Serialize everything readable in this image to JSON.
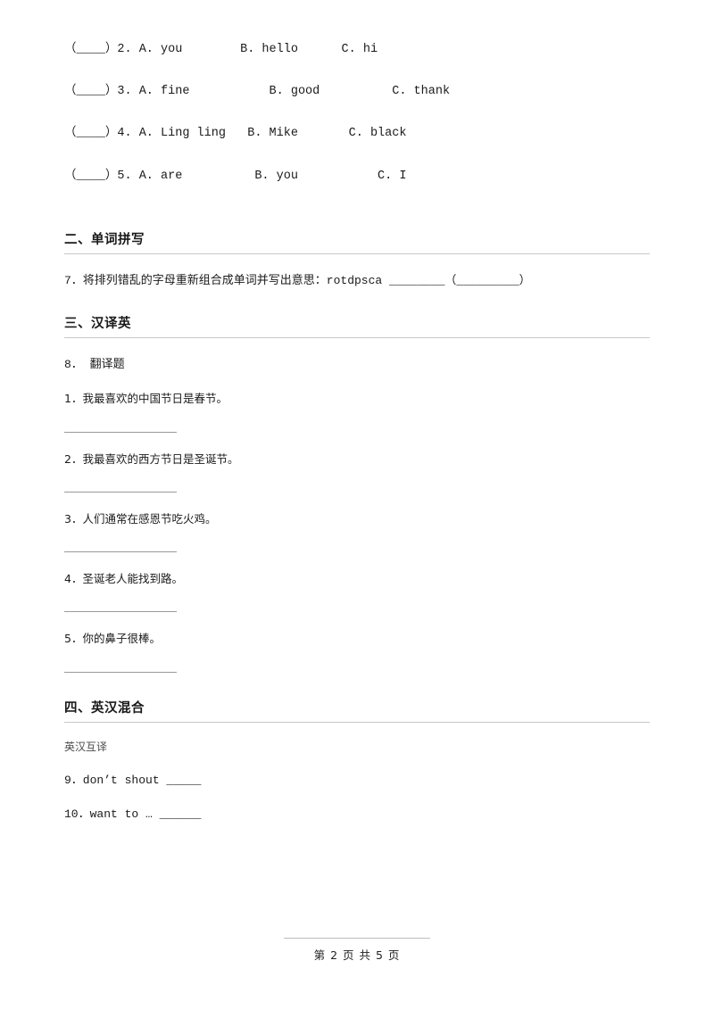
{
  "document": {
    "multiple_choice_continued": [
      "（____）2. A. you        B. hello      C. hi",
      "（____）3. A. fine           B. good          C. thank",
      "（____）4. A. Ling ling   B. Mike       C. black",
      "（____）5. A. are          B. you           C. I"
    ],
    "sections": [
      {
        "heading": "二、单词拼写",
        "items": [
          "7．将排列错乱的字母重新组合成单词并写出意思：rotdpsca ________（_________）"
        ]
      },
      {
        "heading": "三、汉译英",
        "title": "8． 翻译题",
        "questions": [
          "1．我最喜欢的中国节日是春节。",
          "2．我最喜欢的西方节日是圣诞节。",
          "3．人们通常在感恩节吃火鸡。",
          "4．圣诞老人能找到路。",
          "5．你的鼻子很棒。"
        ]
      },
      {
        "heading": "四、英汉混合",
        "subtitle": "英汉互译",
        "items": [
          "9．don’t shout _____",
          "10．want to … ______"
        ]
      }
    ],
    "footer": "第 2 页 共 5 页"
  }
}
